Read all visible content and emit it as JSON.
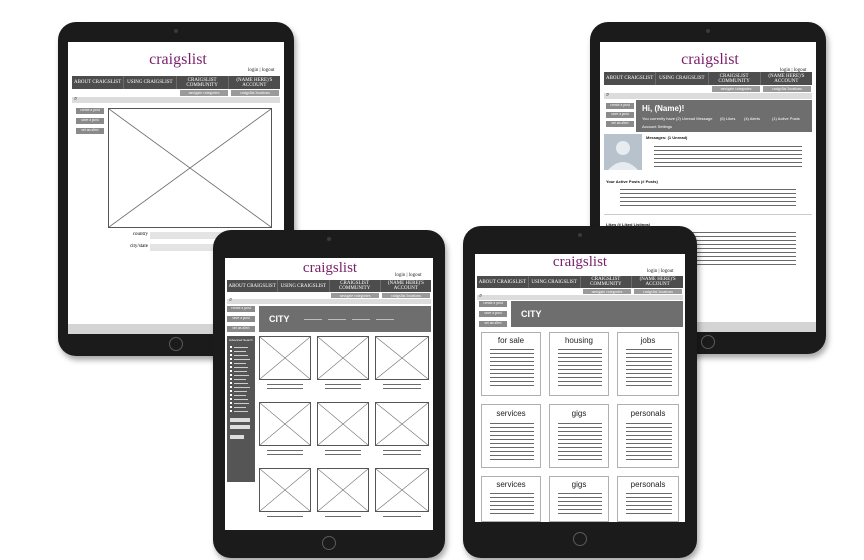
{
  "brand": {
    "logo": "craigslist",
    "login": "login",
    "separator": "|",
    "logout": "logout",
    "logo_color": "#7a1f6a"
  },
  "nav": [
    "ABOUT CRAIGSLIST",
    "USING CRAIGSLIST",
    "CRAIGSLIST COMMUNITY",
    "(NAME HERE)'S ACCOUNT"
  ],
  "subnav": [
    "navigate categories",
    "craigslist locations"
  ],
  "search_icon": "search-icon",
  "side_buttons": [
    "create a post",
    "save a post",
    "set an alert"
  ],
  "tablet1": {
    "country_label": "country",
    "city_label": "city/state"
  },
  "tablet2": {
    "greeting": "Hi, (Name)!",
    "status_line": "You currently have",
    "stat1": "(2) Unread Message",
    "stat2": "(6) Likes",
    "stat3": "(4) Alerts",
    "stat4": "(1) Active Posts",
    "settings": "Account Settings",
    "messages": "Messages: (1 Unread)",
    "active_posts": "Your Active Posts (# Posts)",
    "likes": "Likes (# Liked Listings)"
  },
  "tablet3": {
    "city": "CITY",
    "filter_header": "Advanced Search"
  },
  "tablet4": {
    "city": "CITY",
    "categories": [
      "for sale",
      "housing",
      "jobs",
      "services",
      "gigs",
      "personals",
      "services",
      "gigs",
      "personals"
    ]
  }
}
